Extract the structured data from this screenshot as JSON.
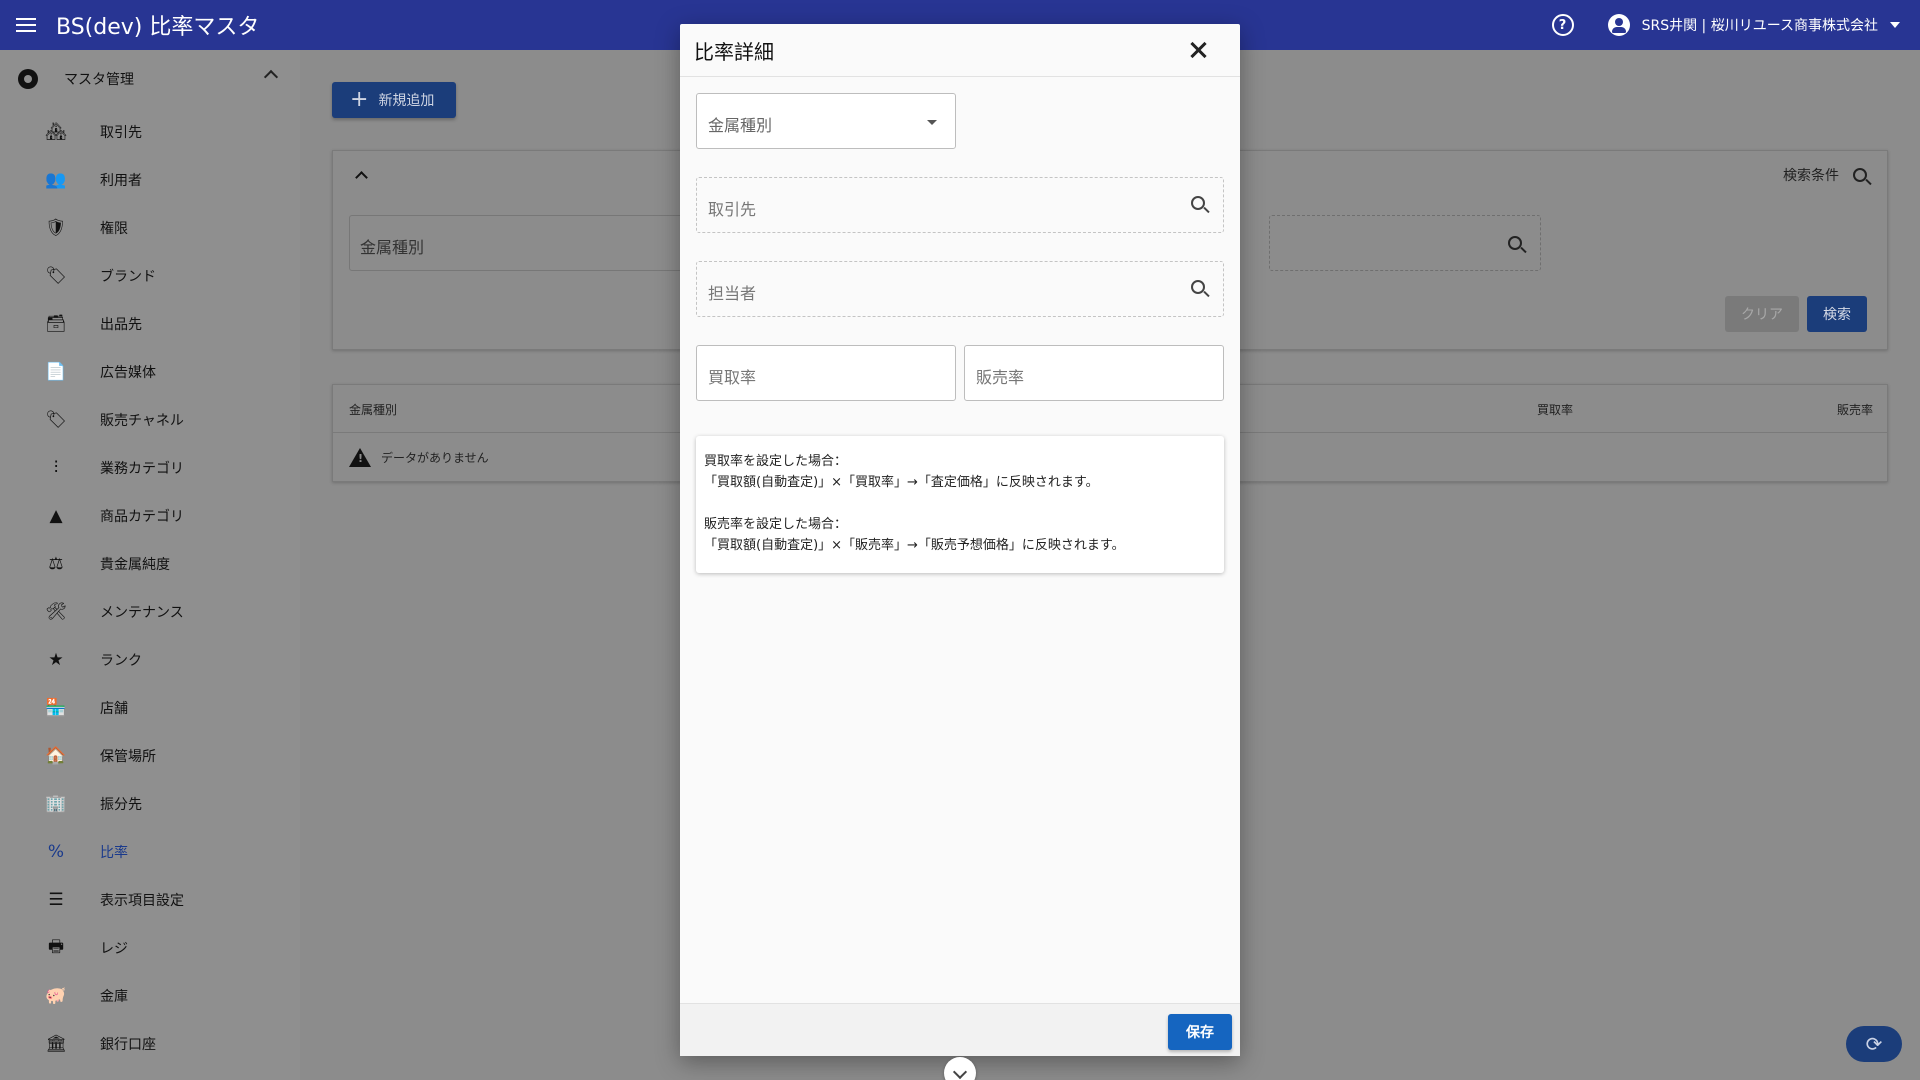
{
  "header": {
    "title": "BS(dev) 比率マスタ",
    "user": "SRS井関 | 桜川リユース商事株式会社"
  },
  "sidebar": {
    "group_label": "マスタ管理",
    "items": [
      {
        "label": "取引先",
        "icon": "🏘"
      },
      {
        "label": "利用者",
        "icon": "👥"
      },
      {
        "label": "権限",
        "icon": "🛡"
      },
      {
        "label": "ブランド",
        "icon": "🏷"
      },
      {
        "label": "出品先",
        "icon": "🗃"
      },
      {
        "label": "広告媒体",
        "icon": "📄"
      },
      {
        "label": "販売チャネル",
        "icon": "🏷"
      },
      {
        "label": "業務カテゴリ",
        "icon": "⫶"
      },
      {
        "label": "商品カテゴリ",
        "icon": "▲"
      },
      {
        "label": "貴金属純度",
        "icon": "⚖"
      },
      {
        "label": "メンテナンス",
        "icon": "🛠"
      },
      {
        "label": "ランク",
        "icon": "★"
      },
      {
        "label": "店舗",
        "icon": "🏪"
      },
      {
        "label": "保管場所",
        "icon": "🏠"
      },
      {
        "label": "振分先",
        "icon": "🏢"
      },
      {
        "label": "比率",
        "icon": "%"
      },
      {
        "label": "表示項目設定",
        "icon": "☰"
      },
      {
        "label": "レジ",
        "icon": "🖶"
      },
      {
        "label": "金庫",
        "icon": "🐖"
      },
      {
        "label": "銀行口座",
        "icon": "🏛"
      }
    ]
  },
  "main": {
    "new_button": "新規追加",
    "search_conditions": "検索条件",
    "search_field": "金属種別",
    "clear_button": "クリア",
    "search_button": "検索",
    "table": {
      "col_metal": "金属種別",
      "col_buy": "買取率",
      "col_sell": "販売率",
      "empty": "データがありません"
    }
  },
  "dialog": {
    "title": "比率詳細",
    "metal_select_placeholder": "金属種別",
    "customer_placeholder": "取引先",
    "staff_placeholder": "担当者",
    "buy_rate_placeholder": "買取率",
    "sell_rate_placeholder": "販売率",
    "info": {
      "buy_heading": "買取率を設定した場合：",
      "buy_formula": "「買取額(自動査定)」×「買取率」→「査定価格」に反映されます。",
      "sell_heading": "販売率を設定した場合：",
      "sell_formula": "「買取額(自動査定)」×「販売率」→「販売予想価格」に反映されます。"
    },
    "save_button": "保存"
  },
  "colors": {
    "appbar": "#283593",
    "primary": "#1565c0"
  }
}
